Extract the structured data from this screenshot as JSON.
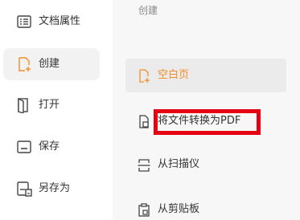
{
  "colors": {
    "accent": "#f28c28",
    "highlight": "#e60012"
  },
  "sidebar": {
    "items": [
      {
        "label": "文档属性",
        "icon": "document-properties-icon",
        "active": false
      },
      {
        "label": "创建",
        "icon": "create-icon",
        "active": true
      },
      {
        "label": "打开",
        "icon": "open-icon",
        "active": false
      },
      {
        "label": "保存",
        "icon": "save-icon",
        "active": false
      },
      {
        "label": "另存为",
        "icon": "save-as-icon",
        "active": false
      }
    ]
  },
  "main": {
    "section_title": "创建",
    "options": [
      {
        "label": "空白页",
        "icon": "blank-page-icon",
        "active": true
      },
      {
        "label": "将文件转换为PDF",
        "icon": "convert-file-icon",
        "active": false,
        "highlighted": true
      },
      {
        "label": "从扫描仪",
        "icon": "scanner-icon",
        "active": false
      },
      {
        "label": "从剪贴板",
        "icon": "clipboard-icon",
        "active": false
      }
    ]
  }
}
